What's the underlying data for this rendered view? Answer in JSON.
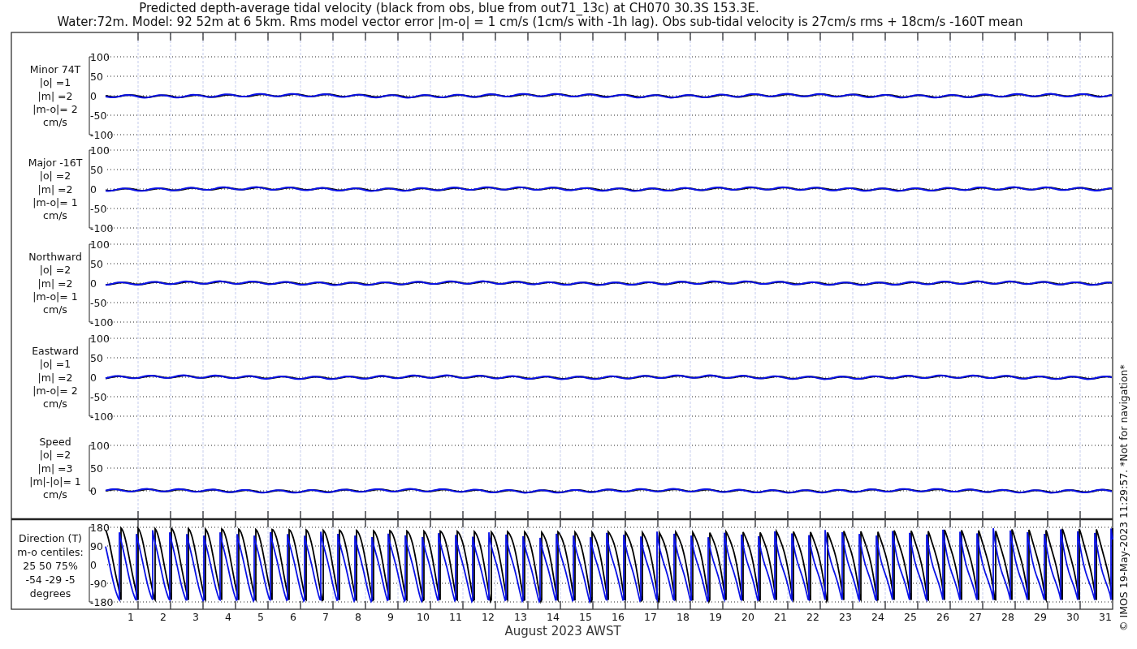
{
  "title": {
    "line1": "Predicted depth-average tidal velocity (black from obs, blue from out71_13c) at CH070 30.3S 153.3E.",
    "line2": "Water:72m. Model: 92 52m at 6 5km. Rms model vector error |m-o| = 1 cm/s (1cm/s with -1h lag). Obs sub-tidal velocity is 27cm/s rms + 18cm/s -160T mean"
  },
  "panels": [
    {
      "label_lines": [
        "Minor 74T",
        "|o| =1",
        "|m| =2",
        "|m-o|= 2",
        "cm/s"
      ],
      "yticks": [
        "100",
        "50",
        "0",
        "-50",
        "-100"
      ]
    },
    {
      "label_lines": [
        "Major -16T",
        "|o| =2",
        "|m| =2",
        "|m-o|= 1",
        "cm/s"
      ],
      "yticks": [
        "100",
        "50",
        "0",
        "-50",
        "-100"
      ]
    },
    {
      "label_lines": [
        "Northward",
        "|o| =2",
        "|m| =2",
        "|m-o|= 1",
        "cm/s"
      ],
      "yticks": [
        "100",
        "50",
        "0",
        "-50",
        "-100"
      ]
    },
    {
      "label_lines": [
        "Eastward",
        "|o| =1",
        "|m| =2",
        "|m-o|= 2",
        "cm/s"
      ],
      "yticks": [
        "100",
        "50",
        "0",
        "-50",
        "-100"
      ]
    },
    {
      "label_lines": [
        "Speed",
        "|o| =2",
        "|m| =3",
        "|m|-|o|= 1",
        "cm/s"
      ],
      "yticks": [
        "100",
        "50",
        "0"
      ]
    }
  ],
  "direction_panel": {
    "label_lines": [
      "Direction (T)",
      "m-o centiles:",
      "25  50  75%",
      "-54 -29  -5",
      "degrees"
    ],
    "yticks": [
      "180",
      "90",
      "0",
      "-90",
      "-180"
    ]
  },
  "x_axis": {
    "day_labels": [
      "1",
      "2",
      "3",
      "4",
      "5",
      "6",
      "7",
      "8",
      "9",
      "10",
      "11",
      "12",
      "13",
      "14",
      "15",
      "16",
      "17",
      "18",
      "19",
      "20",
      "21",
      "22",
      "23",
      "24",
      "25",
      "26",
      "27",
      "28",
      "29",
      "30",
      "31"
    ],
    "xlabel": "August 2023 AWST"
  },
  "side_note": "© IMOS 19-May-2023 11:29:57.  *Not for navigation*"
}
